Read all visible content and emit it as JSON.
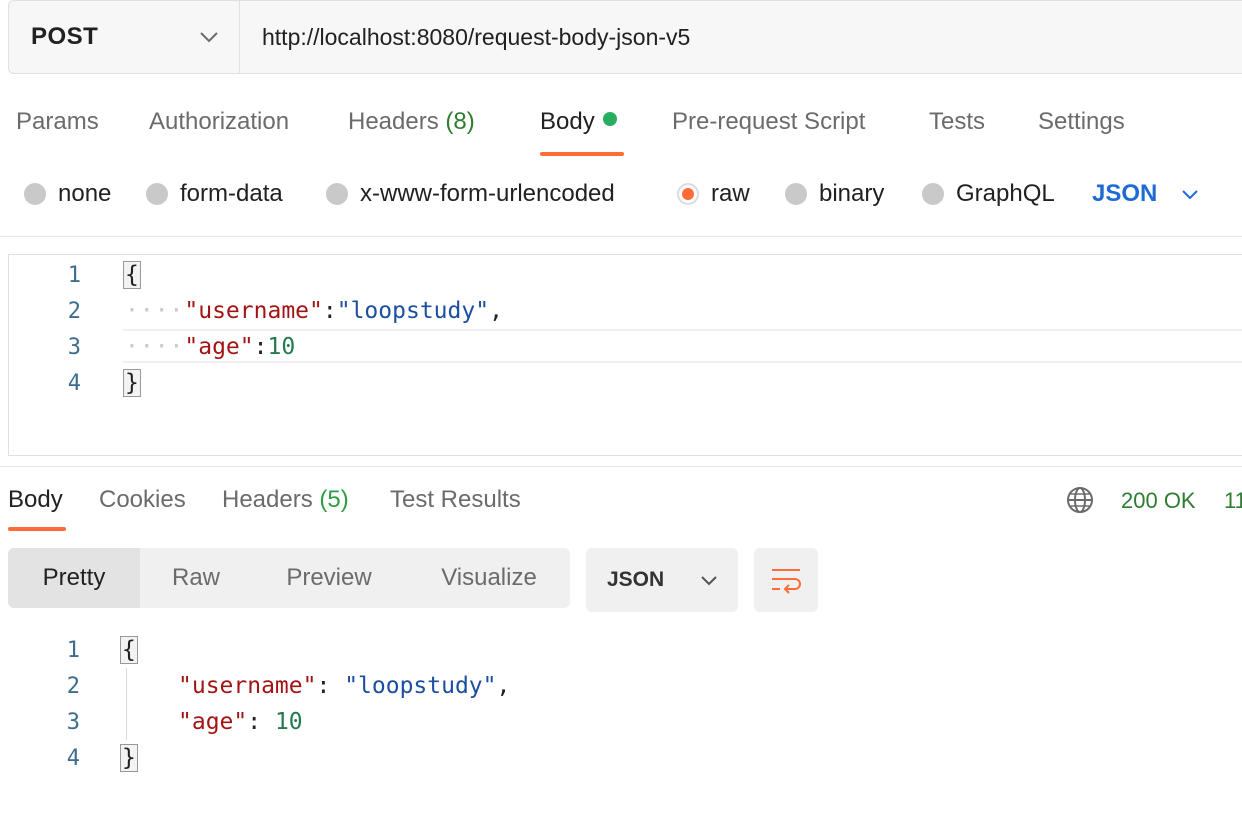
{
  "request": {
    "method": "POST",
    "url": "http://localhost:8080/request-body-json-v5"
  },
  "request_tabs": {
    "params": "Params",
    "authorization": "Authorization",
    "headers": "Headers",
    "headers_count": "(8)",
    "body": "Body",
    "pre_request": "Pre-request Script",
    "tests": "Tests",
    "settings": "Settings"
  },
  "body_types": {
    "none": "none",
    "form_data": "form-data",
    "urlencoded": "x-www-form-urlencoded",
    "raw": "raw",
    "binary": "binary",
    "graphql": "GraphQL",
    "selected": "raw",
    "language": "JSON"
  },
  "request_body": {
    "line_numbers": [
      "1",
      "2",
      "3",
      "4"
    ],
    "open_brace": "{",
    "key1": "\"username\"",
    "colon": ":",
    "val1": "\"loopstudy\"",
    "comma": ",",
    "key2": "\"age\"",
    "val2": "10",
    "close_brace": "}",
    "indent_marker": "····"
  },
  "response_tabs": {
    "body": "Body",
    "cookies": "Cookies",
    "headers": "Headers",
    "headers_count": "(5)",
    "test_results": "Test Results"
  },
  "response_status": {
    "status": "200 OK",
    "time_truncated": "11"
  },
  "response_view": {
    "pretty": "Pretty",
    "raw": "Raw",
    "preview": "Preview",
    "visualize": "Visualize",
    "format": "JSON"
  },
  "response_body": {
    "line_numbers": [
      "1",
      "2",
      "3",
      "4"
    ],
    "open_brace": "{",
    "key1": "\"username\"",
    "colon_space": ": ",
    "val1": "\"loopstudy\"",
    "comma": ",",
    "key2": "\"age\"",
    "val2": "10",
    "close_brace": "}"
  },
  "colors": {
    "accent": "#ff6c37",
    "link_blue": "#1f6bd6",
    "status_green": "#2e7d32",
    "json_key": "#a31515",
    "json_string": "#1c4fa0",
    "json_number": "#247a4f"
  },
  "icons": [
    "chevron-down-icon",
    "globe-icon",
    "wrap-lines-icon"
  ]
}
